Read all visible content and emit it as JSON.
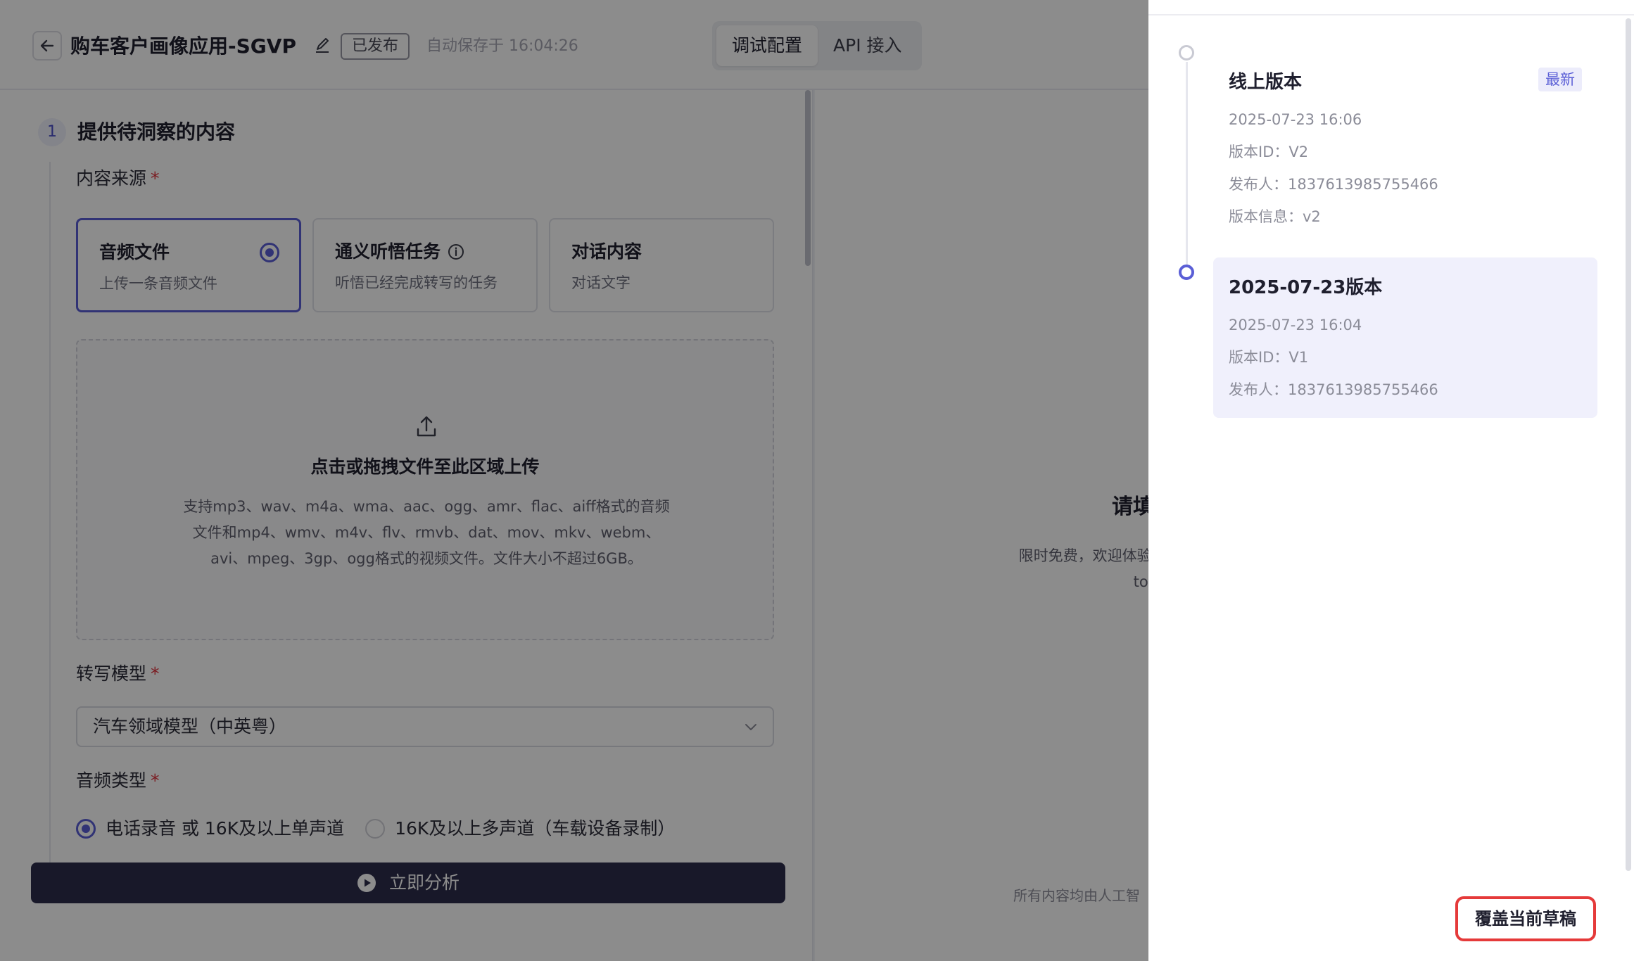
{
  "header": {
    "title": "购车客户画像应用-SGVP",
    "status": "已发布",
    "autosave": "自动保存于 16:04:26",
    "tabs": [
      {
        "label": "调试配置",
        "active": true
      },
      {
        "label": "API 接入",
        "active": false
      }
    ]
  },
  "form": {
    "step_number": "1",
    "step_title": "提供待洞察的内容",
    "source_label": "内容来源",
    "source_cards": [
      {
        "title": "音频文件",
        "subtitle": "上传一条音频文件",
        "selected": true
      },
      {
        "title": "通义听悟任务",
        "subtitle": "听悟已经完成转写的任务",
        "selected": false
      },
      {
        "title": "对话内容",
        "subtitle": "对话文字",
        "selected": false
      }
    ],
    "upload": {
      "title": "点击或拖拽文件至此区域上传",
      "description": "支持mp3、wav、m4a、wma、aac、ogg、amr、flac、aiff格式的音频文件和mp4、wmv、m4v、flv、rmvb、dat、mov、mkv、webm、avi、mpeg、3gp、ogg格式的视频文件。文件大小不超过6GB。"
    },
    "model_label": "转写模型",
    "model_value": "汽车领域模型（中英粤）",
    "audio_type_label": "音频类型",
    "audio_types": [
      {
        "label": "电话录音 或 16K及以上单声道",
        "checked": true
      },
      {
        "label": "16K及以上多声道（车载设备录制）",
        "checked": false
      }
    ],
    "analyze_label": "立即分析"
  },
  "right_panel": {
    "empty_title": "请填",
    "empty_desc": "限时免费，欢迎体验 体验额度，额度用完 token",
    "footer": "所有内容均由人工智"
  },
  "drawer": {
    "versions": [
      {
        "title": "线上版本",
        "tag": "最新",
        "time": "2025-07-23 16:06",
        "version_id": "版本ID：V2",
        "publisher": "发布人：1837613985755466",
        "info": "版本信息：v2",
        "selected": false
      },
      {
        "title": "2025-07-23版本",
        "time": "2025-07-23 16:04",
        "version_id": "版本ID：V1",
        "publisher": "发布人：1837613985755466",
        "selected": true
      }
    ],
    "override_button": "覆盖当前草稿"
  },
  "colors": {
    "accent": "#5a5ed6",
    "primary_button": "#2c2c4c",
    "highlight_border": "#e53a3a",
    "selected_bg": "#f0f0fc"
  }
}
